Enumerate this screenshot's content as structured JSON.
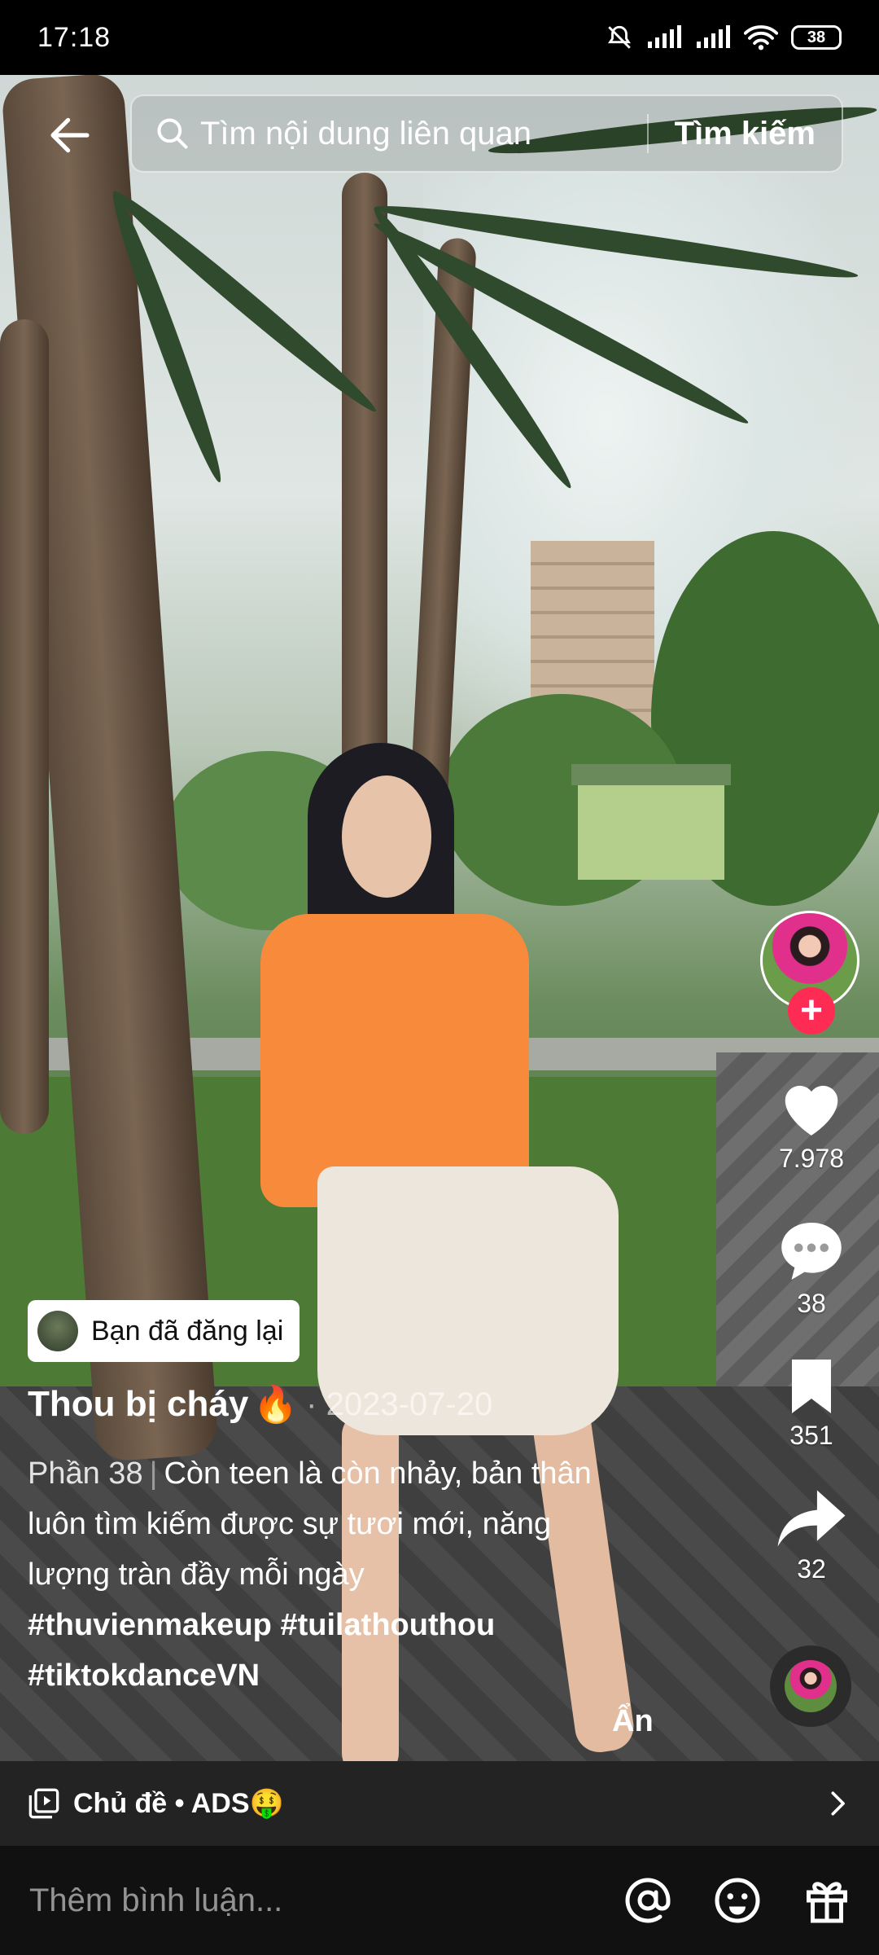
{
  "status_bar": {
    "time": "17:18",
    "battery": "38"
  },
  "search": {
    "placeholder": "Tìm nội dung liên quan",
    "button_label": "Tìm kiếm"
  },
  "rail": {
    "likes": "7.978",
    "comments": "38",
    "saves": "351",
    "shares": "32",
    "follow_symbol": "+"
  },
  "post": {
    "repost_label": "Bạn đã đăng lại",
    "title": "Thou bị cháy",
    "title_emoji": "🔥",
    "date": "· 2023-07-20",
    "part_label": "Phần 38",
    "part_separator": "|",
    "description": "Còn teen là còn nhảy, bản thân luôn tìm kiếm được sự tươi mới, năng lượng tràn đầy mỗi ngày",
    "hashtags": [
      "#thuvienmakeup",
      "#tuilathouthou",
      "#tiktokdanceVN"
    ],
    "hide_label": "Ẩn"
  },
  "topic_bar": {
    "label": "Chủ đề • ADS🤑"
  },
  "comment_bar": {
    "placeholder": "Thêm bình luận..."
  },
  "colors": {
    "follow_accent": "#fe2c55",
    "shirt": "#f88a3c"
  },
  "icons": {
    "back": "arrow-left-icon",
    "search": "search-icon",
    "like": "heart-icon",
    "comment": "comment-bubble-icon",
    "save": "bookmark-icon",
    "share": "share-arrow-icon",
    "topic": "playlist-icon",
    "chevron": "chevron-right-icon",
    "mention": "at-sign-icon",
    "emoji": "emoji-icon",
    "gift": "gift-icon"
  }
}
